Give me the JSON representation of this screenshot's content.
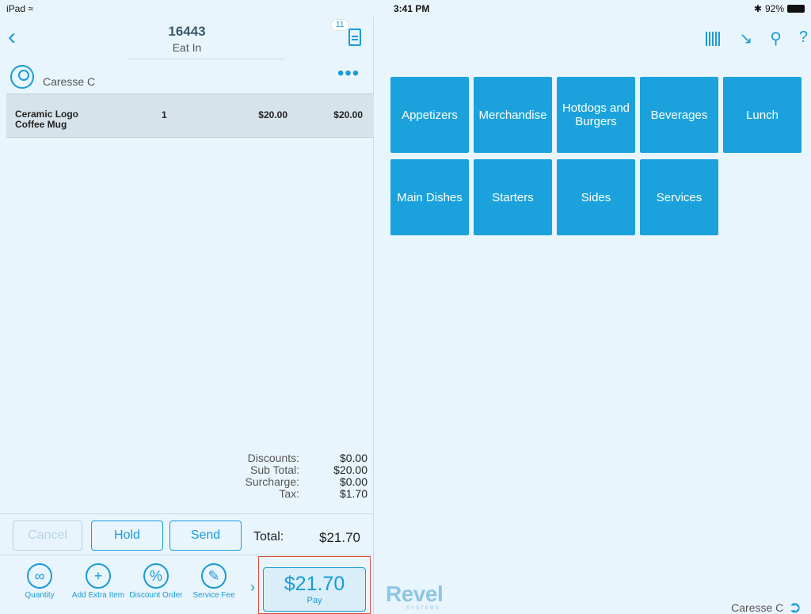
{
  "status_bar": {
    "device": "iPad",
    "wifi_icon": "wifi-icon",
    "time": "3:41 PM",
    "battery": "92%"
  },
  "order": {
    "number": "16443",
    "type": "Eat In",
    "badge_count": "11"
  },
  "customer": {
    "name": "Caresse C"
  },
  "items": [
    {
      "name": "Ceramic Logo Coffee Mug",
      "qty": "1",
      "price": "$20.00",
      "total": "$20.00"
    }
  ],
  "summary": {
    "discounts_label": "Discounts:",
    "discounts": "$0.00",
    "subtotal_label": "Sub Total:",
    "subtotal": "$20.00",
    "surcharge_label": "Surcharge:",
    "surcharge": "$0.00",
    "tax_label": "Tax:",
    "tax": "$1.70"
  },
  "actions": {
    "cancel": "Cancel",
    "hold": "Hold",
    "send": "Send",
    "total_label": "Total:",
    "total": "$21.70"
  },
  "tools": {
    "quantity": "Quantity",
    "add_extra": "Add Extra Item",
    "discount_order": "Discount Order",
    "service_fee": "Service Fee"
  },
  "pay": {
    "amount": "$21.70",
    "label": "Pay"
  },
  "categories": [
    "Appetizers",
    "Merchandise",
    "Hotdogs and Burgers",
    "Beverages",
    "Lunch",
    "Main Dishes",
    "Starters",
    "Sides",
    "Services"
  ],
  "brand": {
    "logo": "Revel",
    "sub": "SYSTEMS"
  },
  "footer_user": "Caresse C",
  "colors": {
    "accent": "#1a9bd7",
    "tile": "#1ba2dc",
    "background": "#e9f5fc",
    "highlight_frame": "#e0483c"
  }
}
